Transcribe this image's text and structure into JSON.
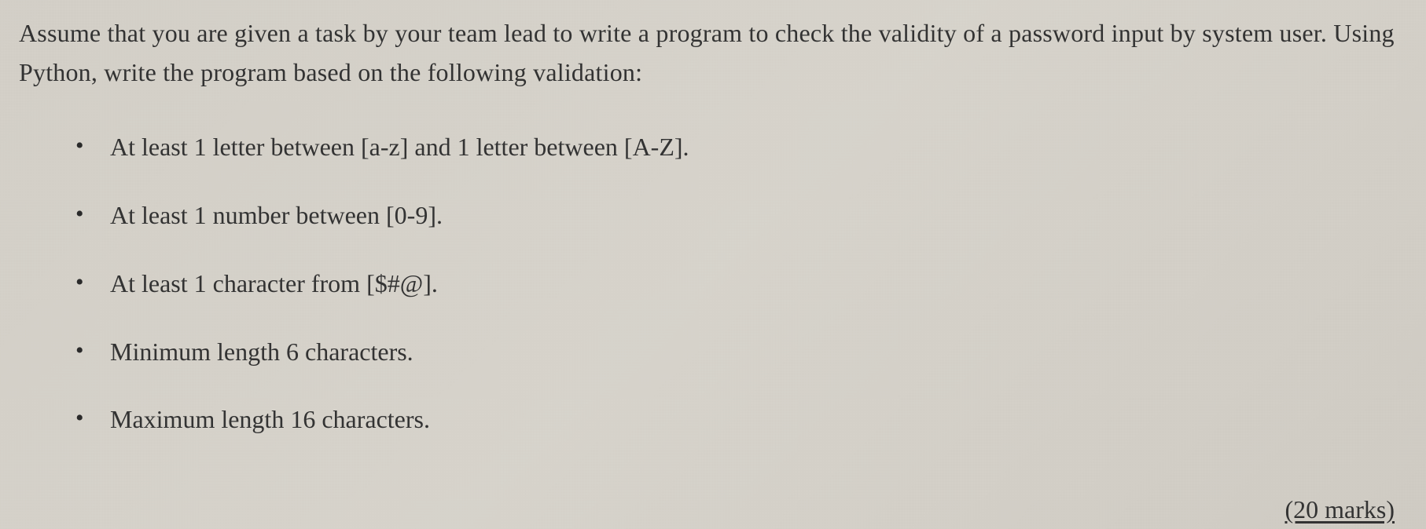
{
  "intro": "Assume that you are given a task by your team lead to write a program to check the validity of a password input by system user. Using Python, write the program based on the following validation:",
  "bullets": [
    "At least 1 letter between [a-z] and 1 letter between [A-Z].",
    "At least 1 number between [0-9].",
    "At least 1 character from [$#@].",
    "Minimum length 6 characters.",
    "Maximum length 16 characters."
  ],
  "marks": "(20 marks)"
}
